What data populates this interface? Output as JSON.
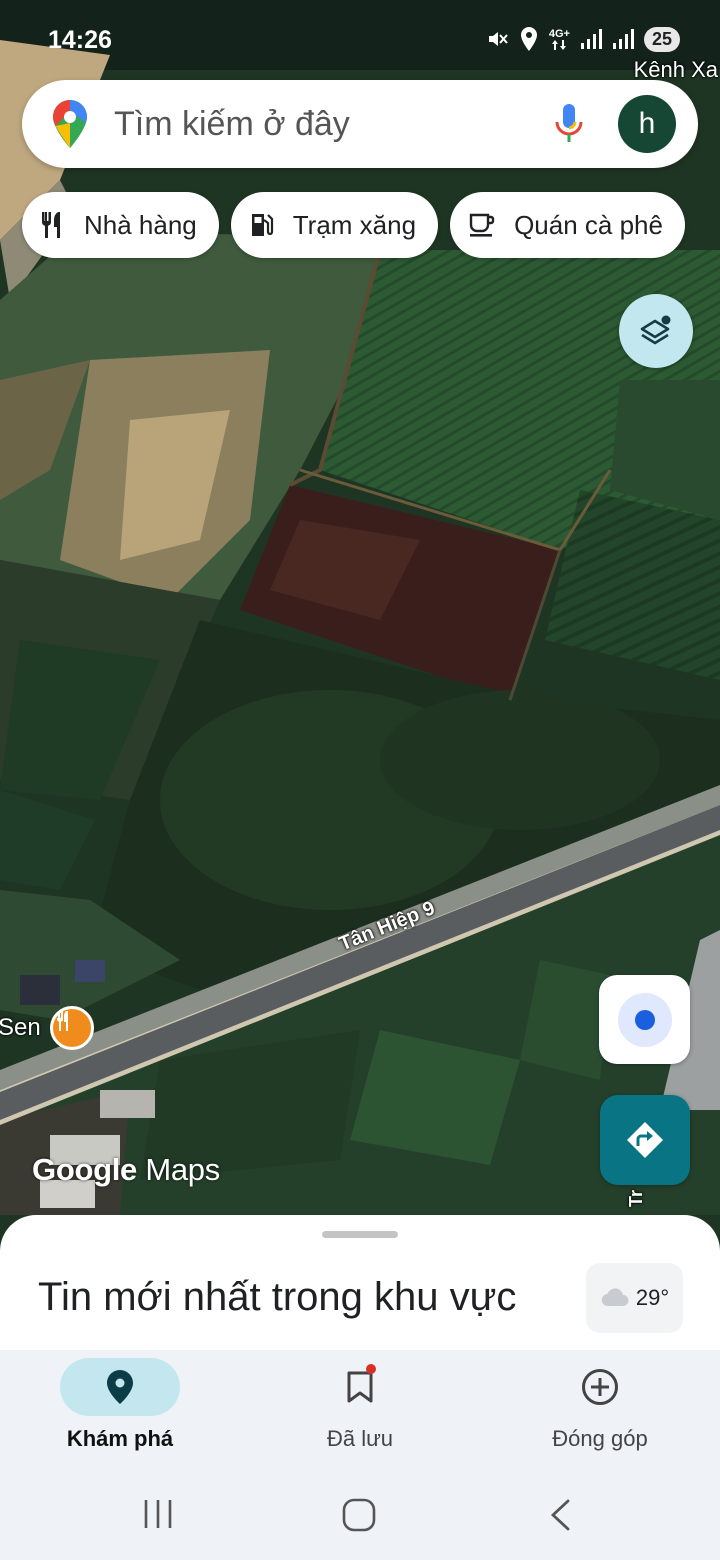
{
  "status_bar": {
    "time": "14:26",
    "network": "4G+",
    "battery": "25",
    "icons": [
      "mute-icon",
      "location-icon",
      "signal-icon",
      "signal-icon"
    ]
  },
  "map": {
    "labels": {
      "channel": "Kênh Xa",
      "road": "Tân Hiệp 9",
      "poi": "Sen",
      "side_road": "Tr"
    },
    "watermark_google": "Google",
    "watermark_maps": "Maps"
  },
  "search": {
    "placeholder": "Tìm kiếm ở đây",
    "avatar_letter": "h"
  },
  "chips": [
    {
      "label": "Nhà hàng",
      "icon": "restaurant-icon"
    },
    {
      "label": "Trạm xăng",
      "icon": "gas-station-icon"
    },
    {
      "label": "Quán cà phê",
      "icon": "cafe-icon"
    }
  ],
  "sheet": {
    "headline": "Tin mới nhất trong khu vực",
    "temperature": "29°"
  },
  "bottom_nav": [
    {
      "label": "Khám phá",
      "icon": "explore-pin-icon",
      "active": true
    },
    {
      "label": "Đã lưu",
      "icon": "bookmark-icon",
      "badge": true
    },
    {
      "label": "Đóng góp",
      "icon": "add-circle-icon"
    }
  ],
  "colors": {
    "accent": "#097484",
    "active_nav": "#c4e7ef",
    "location_dot": "#1a5fde",
    "avatar_bg": "#154734",
    "poi_orange": "#f08c1e"
  }
}
